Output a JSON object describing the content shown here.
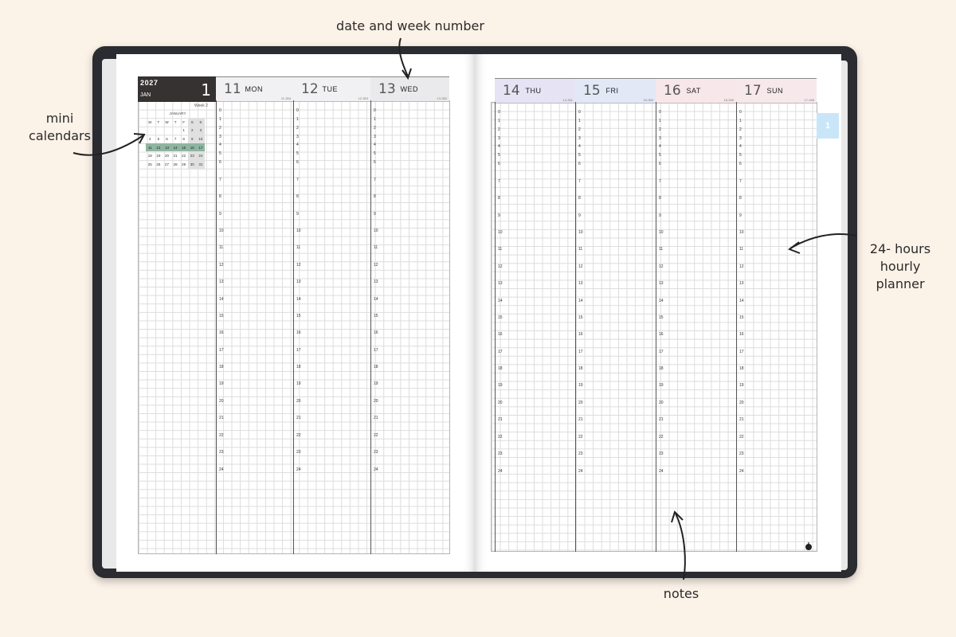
{
  "annotations": {
    "top": "date and week number",
    "left": [
      "mini",
      "calendars"
    ],
    "right": [
      "24- hours",
      "hourly",
      "planner"
    ],
    "bottom": "notes"
  },
  "planner": {
    "year": "2027",
    "month": "JAN",
    "month_number": "1",
    "week_label": "Week 2",
    "tab_label": "1",
    "days": [
      {
        "num": "11",
        "name": "MON",
        "week": "11-354",
        "color": "#f1f1f3"
      },
      {
        "num": "12",
        "name": "TUE",
        "week": "12-353",
        "color": "#f1f1f3"
      },
      {
        "num": "13",
        "name": "WED",
        "week": "13-352",
        "color": "#eaeaec"
      },
      {
        "num": "14",
        "name": "THU",
        "week": "14-351",
        "color": "#e6e3f4"
      },
      {
        "num": "15",
        "name": "FRI",
        "week": "15-350",
        "color": "#e3e8f6"
      },
      {
        "num": "16",
        "name": "SAT",
        "week": "16-349",
        "color": "#f7e6ea"
      },
      {
        "num": "17",
        "name": "SUN",
        "week": "17-348",
        "color": "#f7e8ec"
      }
    ],
    "hours": [
      "0",
      "1",
      "2",
      "3",
      "4",
      "5",
      "6",
      "7",
      "8",
      "9",
      "10",
      "11",
      "12",
      "13",
      "14",
      "15",
      "16",
      "17",
      "18",
      "19",
      "20",
      "21",
      "22",
      "23",
      "24"
    ]
  },
  "mini_calendar": {
    "title": "JANUARY",
    "weekdays": [
      "M",
      "T",
      "W",
      "T",
      "F",
      "S",
      "S"
    ],
    "weeks": [
      [
        "",
        "",
        "",
        "",
        "1",
        "2",
        "3"
      ],
      [
        "4",
        "5",
        "6",
        "7",
        "8",
        "9",
        "10"
      ],
      [
        "11",
        "12",
        "13",
        "14",
        "15",
        "16",
        "17"
      ],
      [
        "18",
        "19",
        "20",
        "21",
        "22",
        "23",
        "24"
      ],
      [
        "25",
        "26",
        "27",
        "28",
        "29",
        "30",
        "31"
      ]
    ],
    "highlight_week_index": 2,
    "highlight_color": "#8fb5a2"
  },
  "colors": {
    "background": "#fbf2e8",
    "cover": "#2a2c31",
    "year_block": "#373232",
    "tab": "#c9e6f8"
  }
}
